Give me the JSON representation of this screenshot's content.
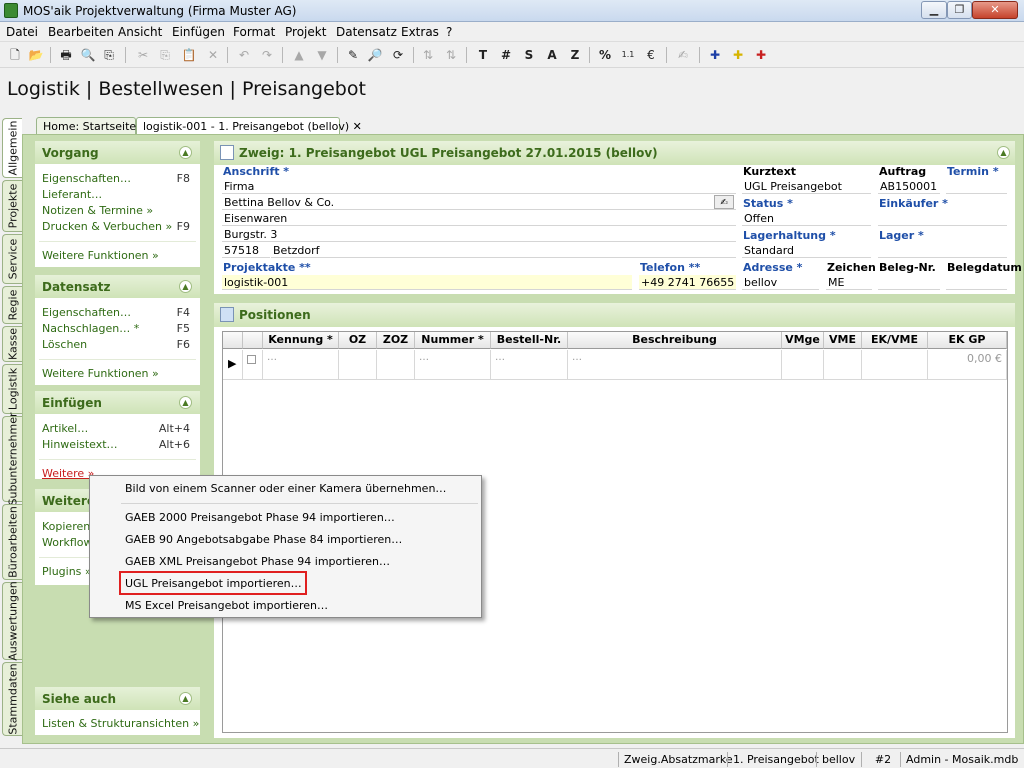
{
  "window": {
    "title": "MOS'aik Projektverwaltung (Firma Muster AG)"
  },
  "menu": [
    "Datei",
    "Bearbeiten",
    "Ansicht",
    "Einfügen",
    "Format",
    "Projekt",
    "Datensatz",
    "Extras",
    "?"
  ],
  "toolbar": {
    "text_buttons": [
      "T",
      "#",
      "S",
      "A",
      "Z",
      "%"
    ]
  },
  "breadcrumb": "Logistik | Bestellwesen | Preisangebot",
  "doc_tabs": [
    "Home: Startseite",
    "logistik-001 - 1. Preisangebot (bellov)"
  ],
  "side_tabs": [
    "Allgemein",
    "Projekte",
    "Service",
    "Regie",
    "Kasse",
    "Logistik",
    "Subunternehmer",
    "Büroarbeiten",
    "Auswertungen",
    "Stammdaten"
  ],
  "left": {
    "vorgang": {
      "title": "Vorgang",
      "items": [
        {
          "label": "Eigenschaften…",
          "shortcut": "F8"
        },
        {
          "label": "Lieferant…",
          "shortcut": ""
        },
        {
          "label": "Notizen & Termine »",
          "shortcut": ""
        },
        {
          "label": "Drucken & Verbuchen »",
          "shortcut": "F9"
        }
      ],
      "more": "Weitere Funktionen »"
    },
    "datensatz": {
      "title": "Datensatz",
      "items": [
        {
          "label": "Eigenschaften…",
          "shortcut": "F4"
        },
        {
          "label": "Nachschlagen… *",
          "shortcut": "F5"
        },
        {
          "label": "Löschen",
          "shortcut": "F6"
        }
      ],
      "more": "Weitere Funktionen »"
    },
    "einfuegen": {
      "title": "Einfügen",
      "items": [
        {
          "label": "Artikel…",
          "shortcut": "Alt+4"
        },
        {
          "label": "Hinweistext…",
          "shortcut": "Alt+6"
        }
      ],
      "more": "Weitere »"
    },
    "weitere": {
      "title": "Weitere",
      "items": [
        "Kopieren",
        "Workflow",
        "Plugins »"
      ]
    },
    "siehe": {
      "title": "Siehe auch",
      "items": [
        "Listen & Strukturansichten »"
      ]
    }
  },
  "header_panel": {
    "title": "Zweig: 1. Preisangebot UGL Preisangebot 27.01.2015 (bellov)"
  },
  "form": {
    "anschrift_label": "Anschrift *",
    "anschrift": [
      "Firma",
      "Bettina Bellov & Co.",
      "Eisenwaren",
      "Burgstr. 3"
    ],
    "plz": "57518",
    "ort": "Betzdorf",
    "kurztext_label": "Kurztext",
    "kurztext": "UGL Preisangebot",
    "auftrag_label": "Auftrag",
    "auftrag": "AB150001",
    "termin_label": "Termin *",
    "status_label": "Status *",
    "status": "Offen",
    "einkaeufer_label": "Einkäufer *",
    "lagerhaltung_label": "Lagerhaltung *",
    "lagerhaltung": "Standard",
    "lager_label": "Lager *",
    "projektakte_label": "Projektakte **",
    "projektakte": "logistik-001",
    "telefon_label": "Telefon **",
    "telefon": "+49 2741 76655",
    "adresse_label": "Adresse *",
    "adresse": "bellov",
    "zeichen_label": "Zeichen",
    "zeichen": "ME",
    "belegnr_label": "Beleg-Nr.",
    "belegdatum_label": "Belegdatum"
  },
  "positionen": {
    "title": "Positionen",
    "columns": [
      "Kennung *",
      "OZ",
      "ZOZ",
      "Nummer *",
      "Bestell-Nr.",
      "Beschreibung",
      "VMge",
      "VME",
      "EK/VME",
      "EK GP"
    ],
    "row": {
      "placeholder": "…",
      "ekgp": "0,00 €"
    }
  },
  "context_menu": {
    "items": [
      "Bild von einem Scanner oder einer Kamera übernehmen…",
      "GAEB 2000 Preisangebot Phase 94 importieren…",
      "GAEB 90 Angebotsabgabe Phase 84 importieren…",
      "GAEB XML Preisangebot Phase 94 importieren…",
      "UGL Preisangebot importieren…",
      "MS Excel Preisangebot importieren…"
    ],
    "highlighted": "UGL Preisangebot importieren…",
    "highlight_color": "#e02020"
  },
  "statusbar": [
    "Zweig.Absatzmarke",
    "1. Preisangebot",
    "bellov",
    "#2",
    "Admin - Mosaik.mdb"
  ],
  "colors": {
    "section_title": "#3d6b1c",
    "link": "#2f6b14",
    "label": "#1f4fa8"
  }
}
